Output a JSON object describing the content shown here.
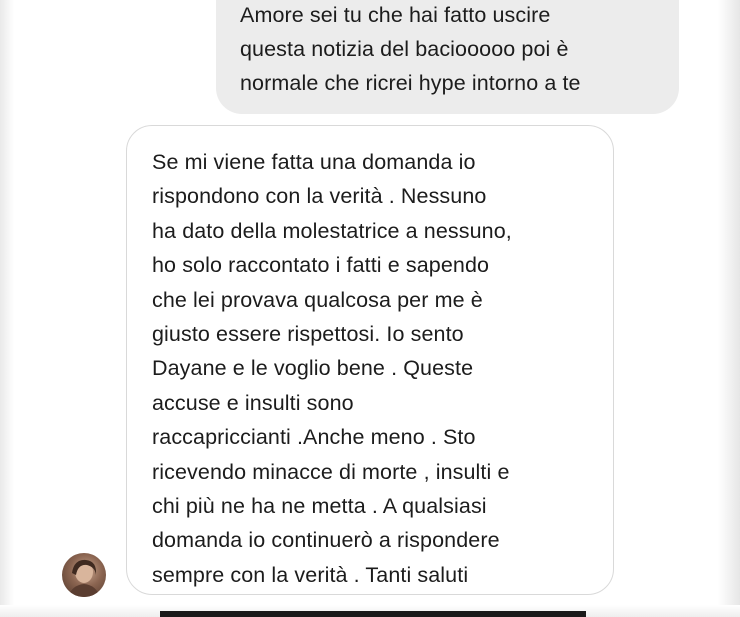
{
  "sent_message": {
    "lines": [
      "Amore sei tu che hai fatto uscire",
      "questa notizia del baciooooo poi è",
      "normale che ricrei hype intorno a te"
    ]
  },
  "received_message": {
    "lines": [
      "Se mi viene fatta una domanda io",
      "rispondono con la verità . Nessuno",
      "ha dato della molestatrice a nessuno,",
      "ho solo raccontato i fatti e sapendo",
      "che lei provava qualcosa per me è",
      "giusto essere rispettosi. Io sento",
      "Dayane e le voglio bene . Queste",
      "accuse e insulti sono",
      "raccapriccianti .Anche meno . Sto",
      "ricevendo minacce di morte , insulti e",
      "chi più ne ha ne metta . A qualsiasi",
      "domanda io continuerò a rispondere",
      "sempre con la verità . Tanti saluti"
    ]
  },
  "contact": {
    "avatar_icon": "profile-photo"
  },
  "colors": {
    "sent_bubble": "#ececec",
    "received_bubble": "#ffffff",
    "received_border": "#d9d9d9",
    "text": "#1c1c1c"
  }
}
